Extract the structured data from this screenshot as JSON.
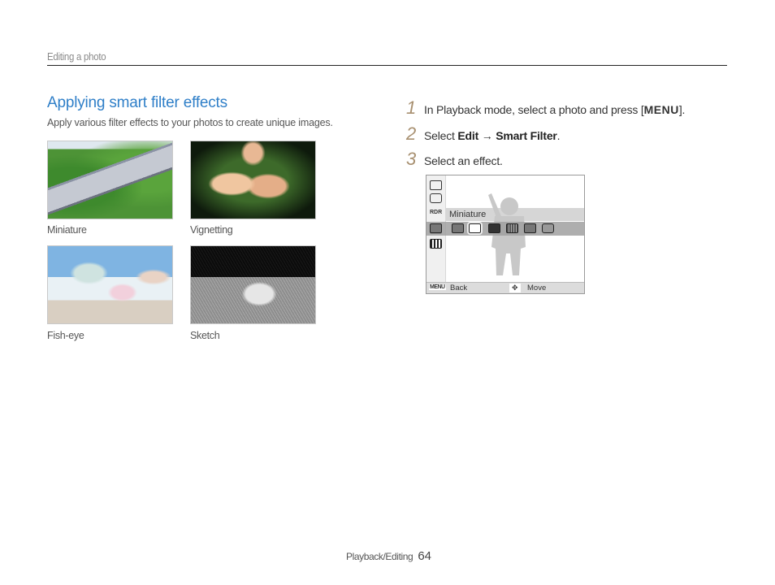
{
  "header": {
    "section": "Editing a photo"
  },
  "main": {
    "title": "Applying smart filter effects",
    "subtitle": "Apply various filter effects to your photos to create unique images.",
    "examples": [
      {
        "caption": "Miniature"
      },
      {
        "caption": "Vignetting"
      },
      {
        "caption": "Fish-eye"
      },
      {
        "caption": "Sketch"
      }
    ]
  },
  "steps": [
    {
      "number": "1",
      "text_before": "In Playback mode, select a photo and press [",
      "key": "MENU",
      "text_after": "]."
    },
    {
      "number": "2",
      "text_before": "Select ",
      "bold1": "Edit",
      "arrow": " → ",
      "bold2": "Smart Filter",
      "text_after": "."
    },
    {
      "number": "3",
      "text": "Select an effect."
    }
  ],
  "camera_screen": {
    "sidebar_icons": [
      "resize-icon",
      "rotate-icon",
      "smart-filter-icon",
      "image-adjust-icon",
      "color-icon"
    ],
    "selected_label": "Miniature",
    "options": [
      "normal",
      "miniature",
      "vignetting",
      "fish-eye",
      "sketch",
      "defog",
      "cross-filter"
    ],
    "selected_option_index": 1,
    "footer": {
      "menu_key": "MENU",
      "back": "Back",
      "move": "Move"
    }
  },
  "footer": {
    "label": "Playback/Editing",
    "page": "64"
  },
  "colors": {
    "title": "#2f7fc8",
    "step_number": "#a89070"
  }
}
